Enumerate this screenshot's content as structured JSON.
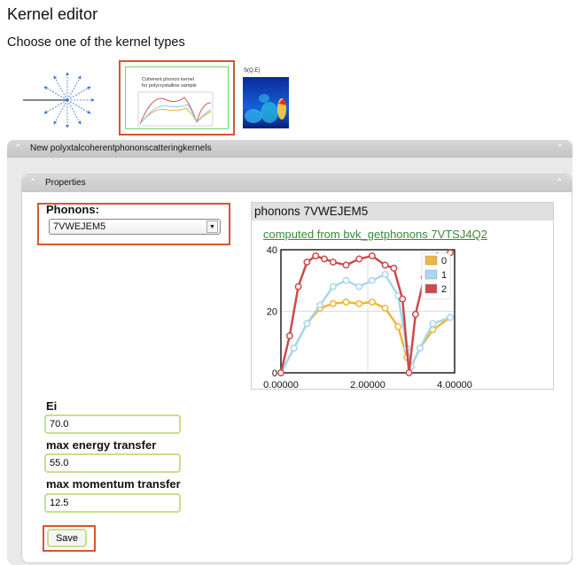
{
  "page_title": "Kernel editor",
  "subtitle": "Choose one of the kernel types",
  "kernel_types": {
    "coherent_caption_line1": "Coherent phonon kernel",
    "coherent_caption_line2": "for polycrystalline sample",
    "sqe_label": "S(Q,E)"
  },
  "outer_panel": {
    "title": "New polyxtalcoherentphononscatteringkernels"
  },
  "inner_panel": {
    "title": "Properties"
  },
  "phonons": {
    "label": "Phonons:",
    "selected": "7VWEJEM5"
  },
  "plot": {
    "title": "phonons 7VWEJEM5",
    "link_text": "computed from bvk_getphonons 7VTSJ4Q2"
  },
  "fields": {
    "ei": {
      "label": "Ei",
      "value": "70.0"
    },
    "max_energy_transfer": {
      "label": "max energy transfer",
      "value": "55.0"
    },
    "max_momentum_transfer": {
      "label": "max momentum transfer",
      "value": "12.5"
    }
  },
  "save_label": "Save",
  "colors": {
    "highlight": "#d9542f",
    "input_border": "#c5e08d",
    "link": "#3a8a3a"
  },
  "chart_data": {
    "type": "line",
    "ylim": [
      0,
      40
    ],
    "xlim": [
      0,
      4
    ],
    "xticks": [
      "0.00000",
      "2.00000",
      "4.00000"
    ],
    "yticks": [
      "0",
      "20",
      "40"
    ],
    "legend_position": "top-right",
    "series": [
      {
        "name": "0",
        "color": "#f0b63a",
        "x": [
          0,
          0.3,
          0.6,
          0.9,
          1.2,
          1.5,
          1.8,
          2.1,
          2.4,
          2.7,
          2.9,
          3.0,
          3.2,
          3.5,
          3.9
        ],
        "y": [
          0,
          8,
          16,
          21,
          22.5,
          23,
          22.5,
          23,
          21,
          15,
          5,
          2,
          8,
          14,
          18
        ]
      },
      {
        "name": "1",
        "color": "#a9d6ef",
        "x": [
          0,
          0.3,
          0.6,
          0.9,
          1.2,
          1.5,
          1.8,
          2.1,
          2.4,
          2.7,
          2.9,
          3.0,
          3.2,
          3.5,
          3.9
        ],
        "y": [
          0,
          8,
          16,
          22,
          28,
          30,
          28,
          30,
          32,
          25,
          8,
          2,
          8,
          16,
          18
        ]
      },
      {
        "name": "2",
        "color": "#cc4a4a",
        "x": [
          0,
          0.2,
          0.4,
          0.6,
          0.8,
          1.0,
          1.2,
          1.5,
          1.8,
          2.1,
          2.4,
          2.6,
          2.8,
          2.95,
          3.1,
          3.3,
          3.6,
          3.9
        ],
        "y": [
          0,
          12,
          28,
          36,
          38,
          37,
          36,
          35,
          37,
          38,
          35,
          34,
          24,
          0,
          19,
          31,
          38,
          39
        ]
      }
    ]
  }
}
